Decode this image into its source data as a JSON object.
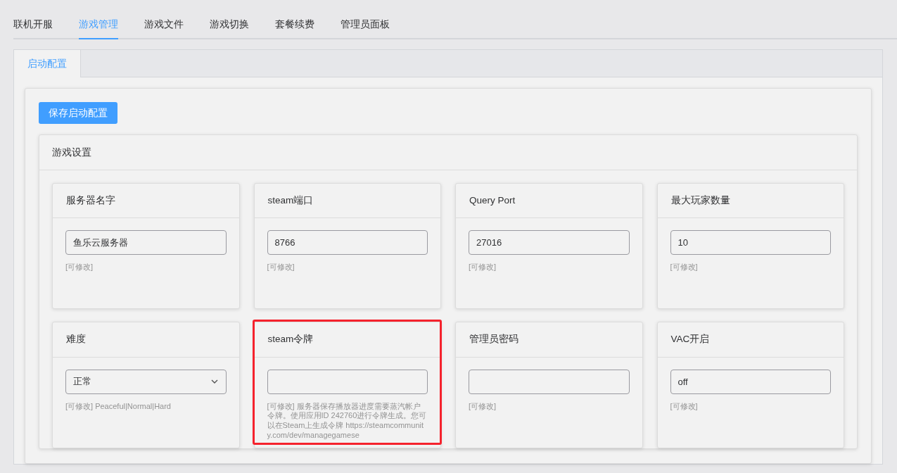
{
  "tabs": [
    {
      "label": "联机开服",
      "selected": false
    },
    {
      "label": "游戏管理",
      "selected": true
    },
    {
      "label": "游戏文件",
      "selected": false
    },
    {
      "label": "游戏切换",
      "selected": false
    },
    {
      "label": "套餐续费",
      "selected": false
    },
    {
      "label": "管理员面板",
      "selected": false
    }
  ],
  "subtabs": [
    {
      "label": "启动配置",
      "selected": true
    }
  ],
  "save_button": "保存启动配置",
  "settings": {
    "title": "游戏设置",
    "fields": [
      {
        "label": "服务器名字",
        "kind": "text",
        "value": "鱼乐云服务器",
        "hint": "[可修改]",
        "highlighted": false
      },
      {
        "label": "steam端口",
        "kind": "text",
        "value": "8766",
        "hint": "[可修改]",
        "highlighted": false
      },
      {
        "label": "Query Port",
        "kind": "text",
        "value": "27016",
        "hint": "[可修改]",
        "highlighted": false
      },
      {
        "label": "最大玩家数量",
        "kind": "text",
        "value": "10",
        "hint": "[可修改]",
        "highlighted": false
      },
      {
        "label": "难度",
        "kind": "select",
        "value": "正常",
        "hint": "[可修改] Peaceful|Normal|Hard",
        "highlighted": false
      },
      {
        "label": "steam令牌",
        "kind": "text",
        "hint": "[可修改] 服务器保存播放器进度需要蒸汽帐户令牌。使用应用ID 242760进行令牌生成。您可以在Steam上生成令牌 https://steamcommunity.com/dev/managegamese",
        "highlighted": true
      },
      {
        "label": "管理员密码",
        "kind": "text",
        "hint": "[可修改]",
        "highlighted": false
      },
      {
        "label": "VAC开启",
        "kind": "text",
        "value": "off",
        "hint": "[可修改]",
        "highlighted": false
      }
    ]
  }
}
